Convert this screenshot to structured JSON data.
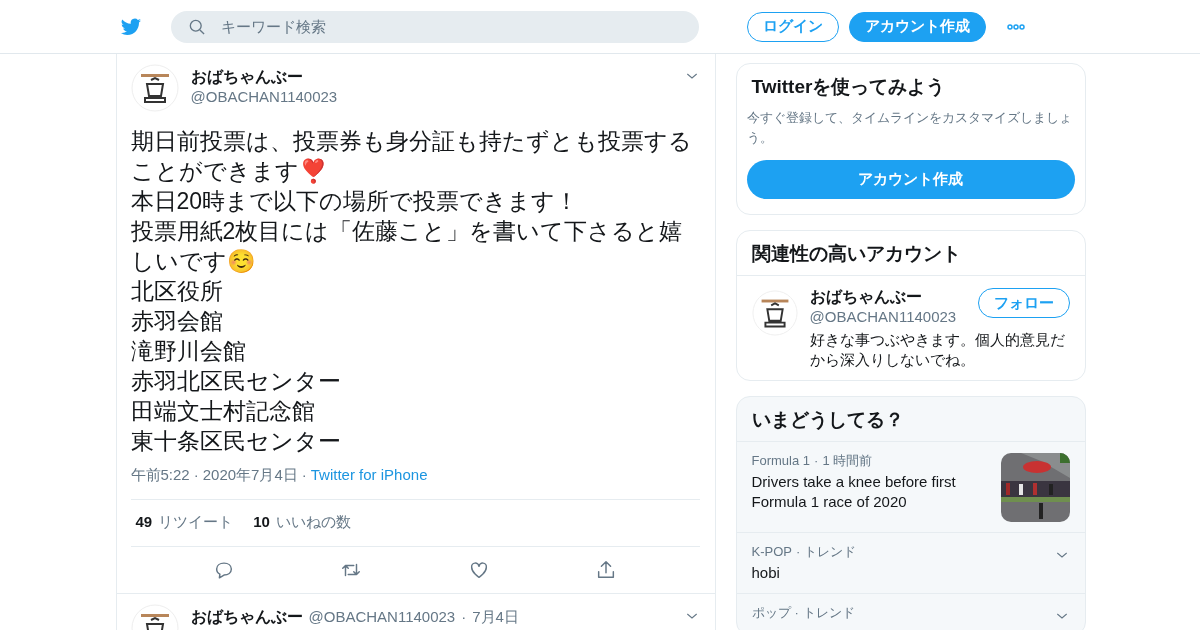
{
  "header": {
    "search": {
      "placeholder": "キーワード検索"
    },
    "login": "ログイン",
    "signup": "アカウント作成"
  },
  "tweet": {
    "name": "おばちゃんぶー",
    "handle": "@OBACHAN1140023",
    "lines": [
      "期日前投票は、投票券も身分証も持たずとも投票することができます❣️",
      "本日20時まで以下の場所で投票できます！",
      "投票用紙2枚目には「佐藤こと」を書いて下さると嬉しいです☺️",
      "北区役所",
      "赤羽会館",
      "滝野川会館",
      "赤羽北区民センター",
      "田端文士村記念館",
      "東十条区民センター"
    ],
    "time": "午前5:22",
    "separators": [
      "·",
      "·"
    ],
    "date": "2020年7月4日",
    "source": "Twitter for iPhone",
    "stats": [
      {
        "count": "49",
        "label": "リツイート"
      },
      {
        "count": "10",
        "label": "いいねの数"
      }
    ]
  },
  "next_tweet": {
    "name": "おばちゃんぶー",
    "handle": "@OBACHAN1140023",
    "separator": "·",
    "date": "7月4日"
  },
  "signup_card": {
    "title": "Twitterを使ってみよう",
    "text": "今すぐ登録して、タイムラインをカスタマイズしましょう。",
    "button": "アカウント作成"
  },
  "related": {
    "title": "関連性の高いアカウント",
    "accounts": [
      {
        "name": "おばちゃんぶー",
        "handle": "@OBACHAN1140023",
        "follow": "フォロー",
        "bio": "好きな事つぶやきます。個人的意見だから深入りしないでね。"
      }
    ]
  },
  "trends": {
    "title": "いまどうしてる？",
    "items": [
      {
        "kind": "news",
        "context": "Formula 1",
        "separator": "·",
        "time": "1 時間前",
        "title": "Drivers take a knee before first Formula 1 race of 2020"
      },
      {
        "kind": "trend",
        "context": "K-POP",
        "separator": "·",
        "time": "トレンド",
        "title": "hobi"
      },
      {
        "kind": "trend",
        "context": "ポップ",
        "separator": "·",
        "time": "トレンド"
      }
    ]
  }
}
